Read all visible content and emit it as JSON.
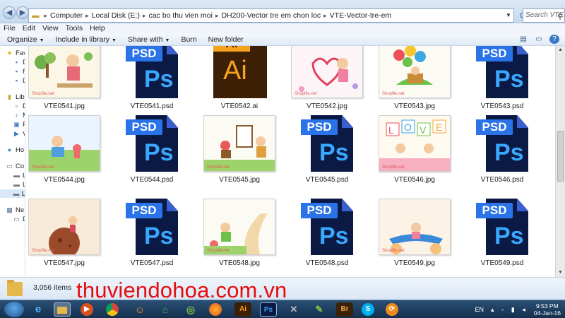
{
  "address": {
    "crumbs": [
      "Computer",
      "Local Disk (E:)",
      "cac bo thu vien moi",
      "DH200-Vector tre em chon loc",
      "VTE-Vector-tre-em"
    ],
    "search_placeholder": "Search VTE..."
  },
  "menu": [
    "File",
    "Edit",
    "View",
    "Tools",
    "Help"
  ],
  "toolbar": {
    "organize": "Organize",
    "include": "Include in library",
    "share": "Share with",
    "burn": "Burn",
    "new_folder": "New folder"
  },
  "nav": {
    "favorites": "Fav",
    "libraries": "Lib",
    "homegroup": "Ho",
    "computer": "Co",
    "network": "Ne",
    "sub_letters": [
      "D",
      "R",
      "D",
      "M",
      "P",
      "V",
      "L",
      "L",
      "L",
      "D"
    ]
  },
  "files": [
    {
      "name": "VTE0541.jpg",
      "kind": "jpg",
      "art": "garden"
    },
    {
      "name": "VTE0541.psd",
      "kind": "psd"
    },
    {
      "name": "VTE0542.ai",
      "kind": "ai"
    },
    {
      "name": "VTE0542.jpg",
      "kind": "jpg",
      "art": "hearts"
    },
    {
      "name": "VTE0543.jpg",
      "kind": "jpg",
      "art": "balloons"
    },
    {
      "name": "VTE0543.psd",
      "kind": "psd"
    },
    {
      "name": "VTE0544.jpg",
      "kind": "jpg",
      "art": "meadow"
    },
    {
      "name": "VTE0544.psd",
      "kind": "psd"
    },
    {
      "name": "VTE0545.jpg",
      "kind": "jpg",
      "art": "painter"
    },
    {
      "name": "VTE0545.psd",
      "kind": "psd"
    },
    {
      "name": "VTE0546.jpg",
      "kind": "jpg",
      "art": "love"
    },
    {
      "name": "VTE0546.psd",
      "kind": "psd"
    },
    {
      "name": "VTE0547.jpg",
      "kind": "jpg",
      "art": "planet"
    },
    {
      "name": "VTE0547.psd",
      "kind": "psd"
    },
    {
      "name": "VTE0548.jpg",
      "kind": "jpg",
      "art": "path"
    },
    {
      "name": "VTE0548.psd",
      "kind": "psd"
    },
    {
      "name": "VTE0549.jpg",
      "kind": "jpg",
      "art": "carpet"
    },
    {
      "name": "VTE0549.psd",
      "kind": "psd"
    }
  ],
  "icons": {
    "psd_band": "PSD",
    "psd_glyph": "Ps",
    "ai_band": "AI",
    "ai_glyph": "Ai",
    "thumb_watermark": "Shopfile.net"
  },
  "status": {
    "count": "3,056 items"
  },
  "watermark": "thuviendohoa.com.vn",
  "taskbar": {
    "apps": [
      "ie",
      "explorer",
      "media-player",
      "chrome",
      "messenger",
      "vpn",
      "cococ",
      "firefox",
      "illustrator",
      "photoshop",
      "x-tool",
      "corel",
      "bridge",
      "skype",
      "download"
    ],
    "ai_label": "Ai",
    "ps_label": "Ps",
    "br_label": "Br",
    "lang": "EN",
    "time": "9:53 PM",
    "date": "04-Jan-16"
  },
  "colors": {
    "psd_dark": "#0b1a45",
    "psd_blue": "#2a73e8",
    "ai_dark": "#3c1f05",
    "ai_orange": "#f6a31d",
    "watermark_red": "#e60d0d"
  }
}
